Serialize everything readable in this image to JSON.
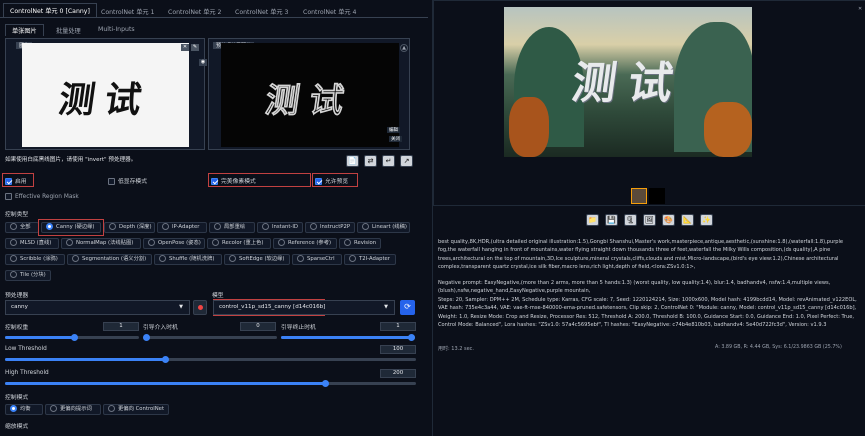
{
  "tabs": [
    {
      "label": "ControlNet 单元 0 [Canny]"
    },
    {
      "label": "ControlNet 单元 1"
    },
    {
      "label": "ControlNet 单元 2"
    },
    {
      "label": "ControlNet 单元 3"
    },
    {
      "label": "ControlNet 单元 4"
    }
  ],
  "subtabs": [
    {
      "label": "单张图片"
    },
    {
      "label": "批量处理"
    },
    {
      "label": "Multi-Inputs"
    }
  ],
  "image_panel": {
    "left_tag": "图像",
    "right_tag": "预处理结果预览",
    "char_text": "测试",
    "preview_edit": "编辑",
    "preview_close": "关闭"
  },
  "hint_text": "如果使用白底黑线图片，请使用 \"invert\" 预处理器。",
  "options": {
    "enable": "启用",
    "lowvram": "低显存模式",
    "pixel_perfect": "完美像素模式",
    "allow_preview": "允许预览"
  },
  "effective_region": "Effective Region Mask",
  "control_type_label": "控制类型",
  "control_types": [
    [
      "全部",
      "Canny (硬边缘)",
      "Depth (深度)",
      "IP-Adapter",
      "局部重绘",
      "Instant-ID",
      "InstructP2P",
      "Lineart (线稿)"
    ],
    [
      "MLSD (直线)",
      "NormalMap (法线贴图)",
      "OpenPose (姿态)",
      "Recolor (重上色)",
      "Reference (参考)",
      "Revision"
    ],
    [
      "Scribble (涂鸦)",
      "Segmentation (语义分割)",
      "Shuffle (随机洗牌)",
      "SoftEdge (软边缘)",
      "SparseCtrl",
      "T2I-Adapter"
    ],
    [
      "Tile (分块)"
    ]
  ],
  "preprocessor": {
    "label": "预处理器",
    "value": "canny"
  },
  "model": {
    "label": "模型",
    "value": "control_v11p_sd15_canny [d14c016b]"
  },
  "control_weight": {
    "label": "控制权重",
    "value": "1"
  },
  "start_step": {
    "label": "引导介入时机",
    "value": "0"
  },
  "end_step": {
    "label": "引导终止时机",
    "value": "1"
  },
  "low_threshold": {
    "label": "Low Threshold",
    "value": "100",
    "fraction": 0.39
  },
  "high_threshold": {
    "label": "High Threshold",
    "value": "200",
    "fraction": 0.78
  },
  "control_mode": {
    "label": "控制模式",
    "options": [
      "均衡",
      "更偏向提示词",
      "更偏向 ControlNet"
    ]
  },
  "resize_mode_label": "缩放模式",
  "output_text": [
    "best quality,8K,HDR,(ultra detailed original illustration:1.5),Gongbi Shanshui,Master's work,masterpiece,antique,aesthetic,(sunshine:1.8),(waterfall:1.8),purple fog,the waterfall hanging in front of mountains,water flying straight down thousands three of feet,waterfall the Milky Wills composition,(ds quality),A pine trees,architectural on the top of mountain,3D,Ice sculpture,mineral crystals,cliffs,clouds and mist,Micro-landscape,(bird's eye view:1.2),Chinese architectural complex,transparent quartz crystal,ice silk fiber,macro lens,rich light,depth of field,<lora:ZSv1.0:1>,",
    "Negative prompt: EasyNegative,(more than 2 arms, more than 5 hands:1.3) (worst quality, low quality:1.4), blur:1.4, badhandv4, nsfw:1.4,multiple views,(blush),nsfw,negative_hand,EasyNegative,purple mountain,",
    "Steps: 20, Sampler: DPM++ 2M, Schedule type: Karras, CFG scale: 7, Seed: 1220124214, Size: 1000x600, Model hash: 4199bcdd14, Model: revAnimated_v122EOL, VAE hash: 735e4c3a44, VAE: vae-ft-mse-840000-ema-pruned.safetensors, Clip skip: 2, ControlNet 0: \"Module: canny, Model: control_v11p_sd15_canny [d14c016b], Weight: 1.0, Resize Mode: Crop and Resize, Processor Res: 512, Threshold A: 200.0, Threshold B: 100.0, Guidance Start: 0.0, Guidance End: 1.0, Pixel Perfect: True, Control Mode: Balanced\", Lora hashes: \"ZSv1.0: 57a4c5695ebf\", TI hashes: \"EasyNegative: c74b4e810b03, badhandv4: 5e40d722fc3d\", Version: v1.9.3"
  ],
  "time_taken": "用时: 13.2 sec.",
  "stats": "A: 3.89 GB, R: 4.44 GB, Sys: 6.1/23.9863 GB (25.7%)",
  "colors": {
    "accent": "#3b82f6",
    "highlight": "#c24141",
    "panel": "#0b0f19"
  },
  "icons": [
    "close-icon",
    "pencil-icon",
    "camera-icon",
    "upload-icon",
    "swap-icon",
    "explosion-icon",
    "folder-icon",
    "save-icon",
    "zip-icon",
    "palette-icon",
    "ruler-icon",
    "sparkle-icon",
    "refresh-icon",
    "fire-icon"
  ]
}
